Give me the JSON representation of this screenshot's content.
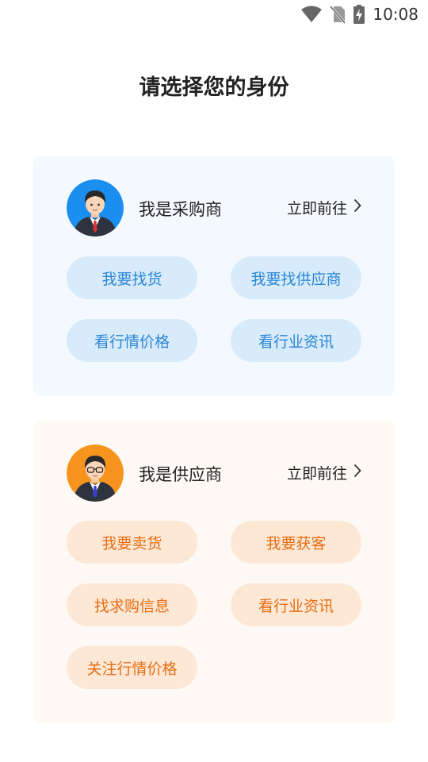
{
  "status_bar": {
    "time": "10:08",
    "icons": [
      "wifi-icon",
      "no-sim-icon",
      "battery-charging-icon"
    ]
  },
  "page": {
    "title": "请选择您的身份"
  },
  "colors": {
    "buyer_card_bg": "#f3f9fe",
    "buyer_chip_bg": "#d7ebfb",
    "buyer_chip_text": "#2b86d6",
    "supplier_card_bg": "#fef9f4",
    "supplier_chip_bg": "#fde8d6",
    "supplier_chip_text": "#e86d12"
  },
  "buyer": {
    "title": "我是采购商",
    "goto": "立即前往",
    "avatar_icon": "businessman-avatar-blue",
    "actions": [
      "我要找货",
      "我要找供应商",
      "看行情价格",
      "看行业资讯"
    ]
  },
  "supplier": {
    "title": "我是供应商",
    "goto": "立即前往",
    "avatar_icon": "businessman-avatar-orange",
    "actions": [
      "我要卖货",
      "我要获客",
      "找求购信息",
      "看行业资讯",
      "关注行情价格"
    ]
  }
}
